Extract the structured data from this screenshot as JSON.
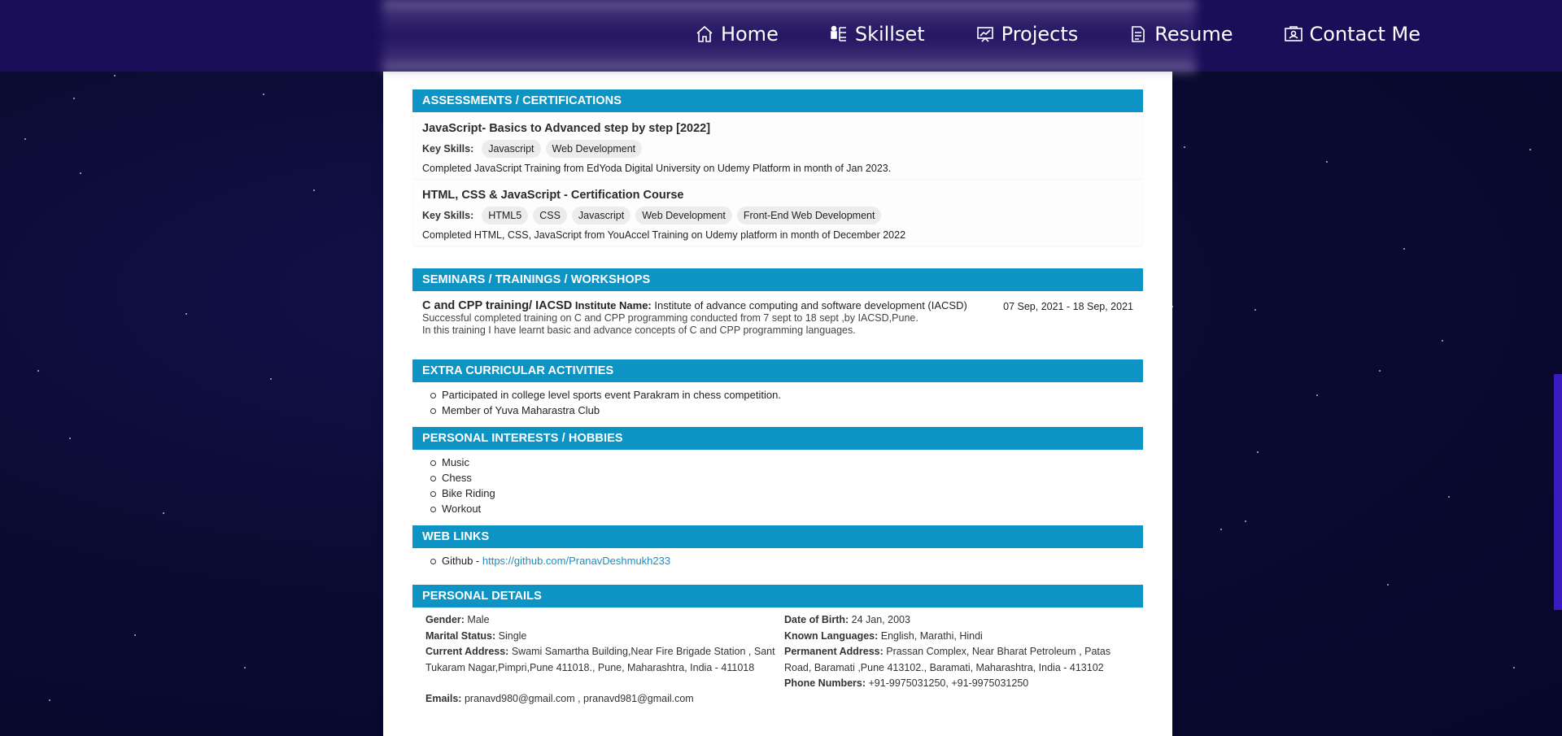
{
  "nav": {
    "items": [
      {
        "label": "Home",
        "icon": "home-icon"
      },
      {
        "label": "Skillset",
        "icon": "skillset-icon"
      },
      {
        "label": "Projects",
        "icon": "projects-icon"
      },
      {
        "label": "Resume",
        "icon": "resume-icon"
      },
      {
        "label": "Contact Me",
        "icon": "contact-icon"
      }
    ]
  },
  "certifications": {
    "heading": "ASSESSMENTS / CERTIFICATIONS",
    "key_skills_label": "Key Skills:",
    "items": [
      {
        "title": "JavaScript- Basics to Advanced step by step [2022]",
        "skills": [
          "Javascript",
          "Web Development"
        ],
        "desc": "Completed JavaScript Training from EdYoda Digital University on Udemy Platform in month of Jan 2023."
      },
      {
        "title": "HTML, CSS & JavaScript - Certification Course",
        "skills": [
          "HTML5",
          "CSS",
          "Javascript",
          "Web Development",
          "Front-End Web Development"
        ],
        "desc": "Completed HTML, CSS, JavaScript from YouAccel Training on Udemy platform in month of December 2022"
      }
    ]
  },
  "trainings": {
    "heading": "SEMINARS / TRAININGS / WORKSHOPS",
    "item": {
      "title": "C and CPP training/ IACSD",
      "institute_label": "Institute Name:",
      "institute": "Institute of advance computing and software development (IACSD)",
      "dates": "07 Sep, 2021  -  18 Sep, 2021",
      "desc1": "Successful completed training on C and CPP programming conducted from 7 sept to 18 sept ,by IACSD,Pune.",
      "desc2": "In this training I have learnt basic and advance concepts of C and CPP programming languages."
    }
  },
  "extra": {
    "heading": "EXTRA CURRICULAR ACTIVITIES",
    "items": [
      "Participated in college level sports event Parakram in chess competition.",
      "Member of Yuva Maharastra Club"
    ]
  },
  "hobbies": {
    "heading": "PERSONAL INTERESTS / HOBBIES",
    "items": [
      "Music",
      "Chess",
      "Bike Riding",
      "Workout"
    ]
  },
  "weblinks": {
    "heading": "WEB LINKS",
    "label": "Github - ",
    "url": "https://github.com/PranavDeshmukh233"
  },
  "personal": {
    "heading": "PERSONAL DETAILS",
    "gender_label": "Gender:",
    "gender": "Male",
    "marital_label": "Marital Status:",
    "marital": "Single",
    "current_addr_label": "Current Address:",
    "current_addr": "Swami Samartha Building,Near Fire Brigade Station , Sant Tukaram Nagar,Pimpri,Pune 411018., Pune, Maharashtra, India - 411018",
    "emails_label": "Emails:",
    "emails": "pranavd980@gmail.com , pranavd981@gmail.com",
    "dob_label": "Date of Birth:",
    "dob": "24 Jan, 2003",
    "languages_label": "Known Languages:",
    "languages": "English, Marathi, Hindi",
    "perm_addr_label": "Permanent Address:",
    "perm_addr": "Prassan Complex, Near Bharat Petroleum , Patas Road, Baramati ,Pune 413102., Baramati, Maharashtra, India - 413102",
    "phone_label": "Phone Numbers:",
    "phone": "+91-9975031250, +91-9975031250"
  }
}
